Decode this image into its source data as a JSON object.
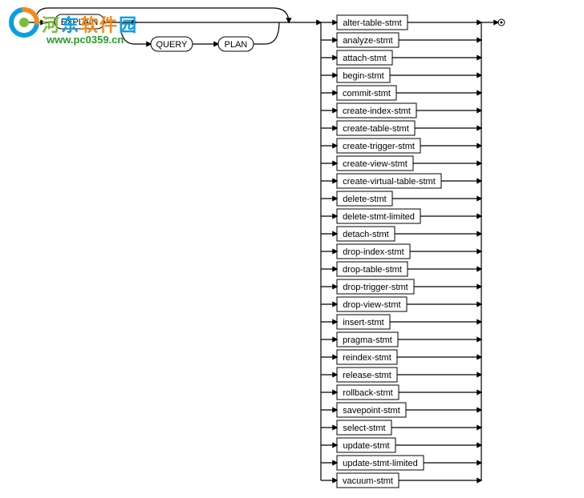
{
  "watermark": {
    "site_name_chars": [
      "河",
      "东",
      "软",
      "件",
      "园"
    ],
    "site_name_colors": [
      "#7bbd3a",
      "#0aa0e0",
      "#f08c1e",
      "#f08c1e",
      "#0aa0e0"
    ],
    "url": "www.pc0359.cn"
  },
  "diagram": {
    "keywords": {
      "explain": "EXPLAIN",
      "query": "QUERY",
      "plan": "PLAN"
    },
    "statements": [
      "alter-table-stmt",
      "analyze-stmt",
      "attach-stmt",
      "begin-stmt",
      "commit-stmt",
      "create-index-stmt",
      "create-table-stmt",
      "create-trigger-stmt",
      "create-view-stmt",
      "create-virtual-table-stmt",
      "delete-stmt",
      "delete-stmt-limited",
      "detach-stmt",
      "drop-index-stmt",
      "drop-table-stmt",
      "drop-trigger-stmt",
      "drop-view-stmt",
      "insert-stmt",
      "pragma-stmt",
      "reindex-stmt",
      "release-stmt",
      "rollback-stmt",
      "savepoint-stmt",
      "select-stmt",
      "update-stmt",
      "update-stmt-limited",
      "vacuum-stmt"
    ]
  }
}
